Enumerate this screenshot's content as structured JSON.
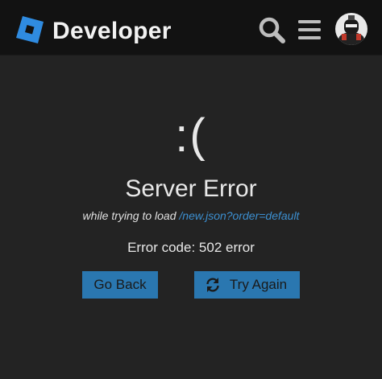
{
  "header": {
    "brand": "Developer",
    "icons": {
      "logo": "roblox-logo-icon",
      "search": "search-icon",
      "menu": "hamburger-menu-icon",
      "avatar": "user-avatar"
    }
  },
  "error": {
    "face": ":(",
    "title": "Server Error",
    "detail_prefix": "while trying to load",
    "detail_link": "/new.json?order=default",
    "code": "Error code: 502 error"
  },
  "buttons": {
    "back": "Go Back",
    "retry": "Try Again"
  },
  "colors": {
    "background": "#232323",
    "header": "#121212",
    "link": "#3c8fd0",
    "button": "#2a77b0"
  }
}
